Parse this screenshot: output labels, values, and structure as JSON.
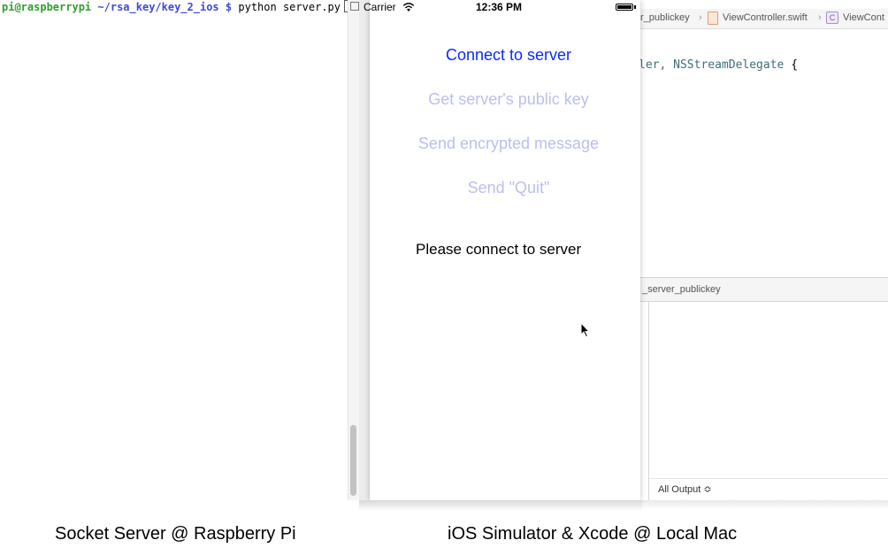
{
  "terminal": {
    "user_host": "pi@raspberrypi",
    "path": "~/rsa_key/key_2_ios",
    "prompt": "$",
    "command": "python server.py"
  },
  "simulator": {
    "status_bar": {
      "carrier": "Carrier",
      "time": "12:36 PM"
    },
    "buttons": {
      "connect": "Connect to server",
      "get_key": "Get server's public key",
      "send_encrypted": "Send encrypted message",
      "send_quit": "Send \"Quit\""
    },
    "status_label": "Please connect to server",
    "colors": {
      "active_button": "#0a2bff",
      "disabled_button": "#b9bff0"
    }
  },
  "xcode": {
    "jump_bar": {
      "group": "r_publickey",
      "file": "ViewController.swift",
      "symbol_icon": "C",
      "symbol": "ViewCont"
    },
    "code_fragment": {
      "prefix": "ler, ",
      "protocol": "NSStreamDelegate",
      "suffix": " {"
    },
    "debug_bar_label": "_server_publickey",
    "output_selector": "All Output ≎"
  },
  "captions": {
    "left": "Socket Server @ Raspberry Pi",
    "right": "iOS Simulator & Xcode @ Local Mac"
  }
}
